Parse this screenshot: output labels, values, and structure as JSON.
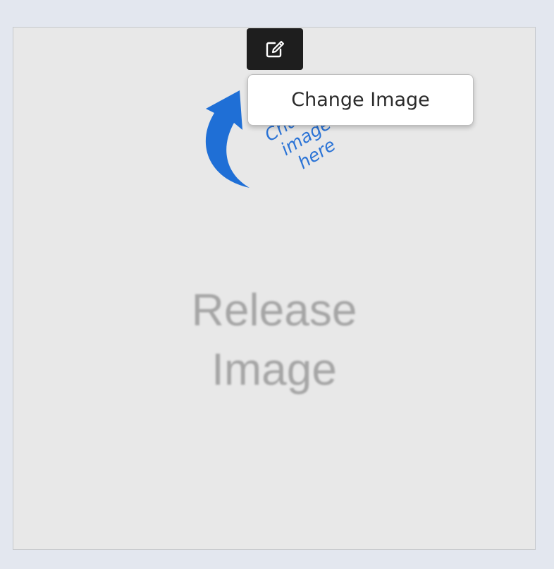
{
  "image_placeholder": {
    "line1": "Release",
    "line2": "Image"
  },
  "hint": {
    "line1": "Change",
    "line2": "image",
    "line3": "here",
    "color": "#2a73d6"
  },
  "edit_button": {
    "icon": "edit-icon",
    "background": "#1e1e1e"
  },
  "menu": {
    "items": [
      {
        "label": "Change Image"
      }
    ]
  }
}
